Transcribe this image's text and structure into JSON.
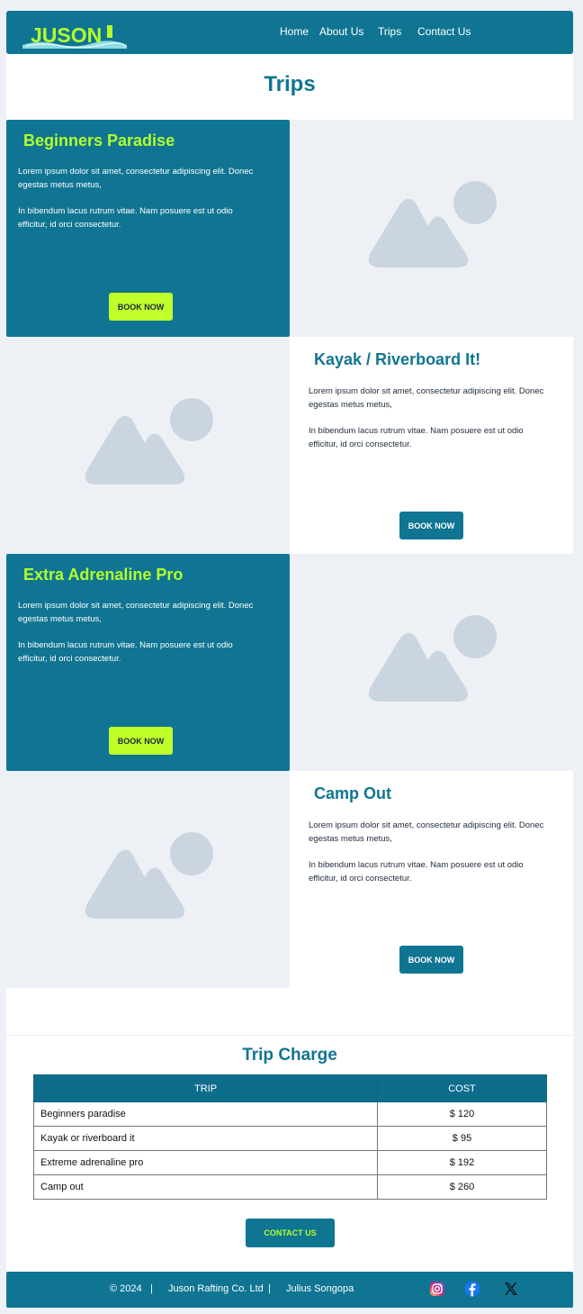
{
  "header": {
    "logo_text": "JUSON",
    "nav": [
      "Home",
      "About Us",
      "Trips",
      "Contact Us"
    ]
  },
  "page_title": "Trips",
  "trips": [
    {
      "title": "Beginners Paradise",
      "para1": " Lorem ipsum dolor sit amet, consectetur adipiscing elit. Donec egestas metus metus,",
      "para2": "In bibendum lacus rutrum vitae.  Nam posuere est ut odio efficitur, id orci consectetur.",
      "button": "BOOK NOW"
    },
    {
      "title": "Kayak / Riverboard It!",
      "para1": " Lorem ipsum dolor sit amet, consectetur adipiscing elit. Donec egestas metus metus,",
      "para2": "In bibendum lacus rutrum vitae.  Nam posuere est ut odio efficitur, id orci consectetur.",
      "button": "BOOK NOW"
    },
    {
      "title": "Extra Adrenaline Pro",
      "para1": " Lorem ipsum dolor sit amet, consectetur adipiscing elit. Donec egestas metus metus,",
      "para2": "In bibendum lacus rutrum vitae.  Nam posuere est ut odio efficitur, id orci consectetur.",
      "button": "BOOK NOW"
    },
    {
      "title": "Camp Out",
      "para1": " Lorem ipsum dolor sit amet, consectetur adipiscing elit. Donec egestas metus metus,",
      "para2": "In bibendum lacus rutrum vitae.  Nam posuere est ut odio efficitur, id orci consectetur.",
      "button": "BOOK NOW"
    }
  ],
  "charge": {
    "title": "Trip Charge",
    "headers": [
      "TRIP",
      "COST"
    ],
    "rows": [
      [
        "Beginners paradise",
        "$ 120"
      ],
      [
        "Kayak or riverboard it",
        "$ 95"
      ],
      [
        "Extreme adrenaline pro",
        "$ 192"
      ],
      [
        "Camp out",
        "$ 260"
      ]
    ],
    "button": "CONTACT US"
  },
  "footer": {
    "copyright": "© 2024",
    "sep": "|",
    "company": "Juson Rafting Co. Ltd",
    "author": "Julius Songopa",
    "social": [
      "instagram-icon",
      "facebook-icon",
      "x-icon"
    ]
  },
  "colors": {
    "primary": "#107592",
    "accent": "#b4ff2b",
    "placeholder_bg": "#edf1f5",
    "placeholder_shape": "#cbd5e0"
  }
}
